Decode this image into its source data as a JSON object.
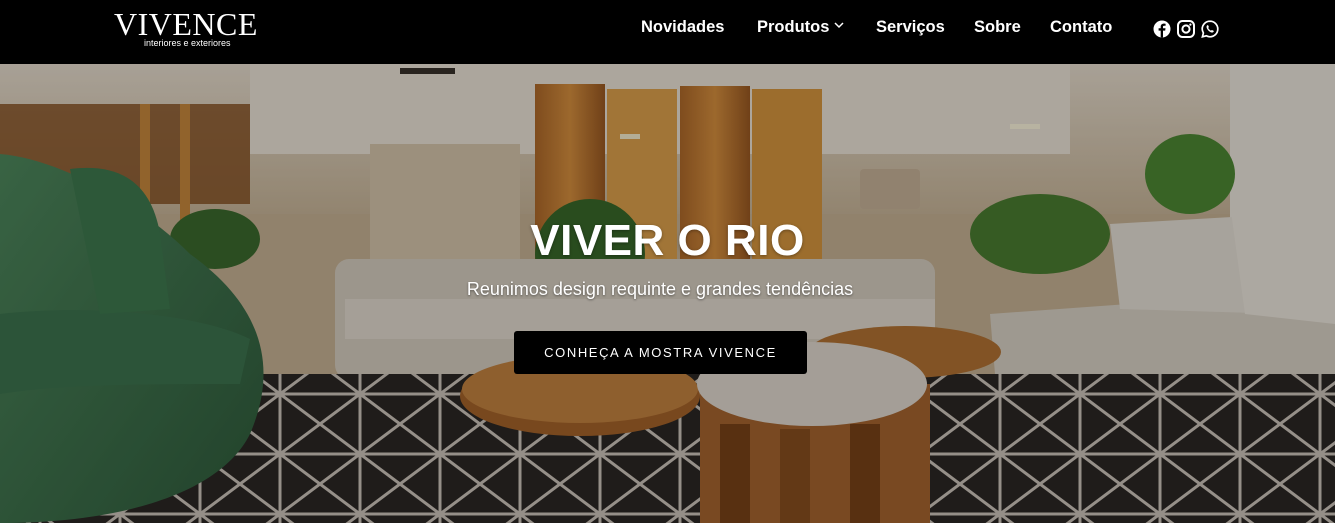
{
  "header": {
    "logo": {
      "main": "VIVENCE",
      "tagline": "interiores e exteriores"
    },
    "nav": [
      {
        "label": "Novidades"
      },
      {
        "label": "Produtos",
        "has_dropdown": true
      },
      {
        "label": "Serviços"
      },
      {
        "label": "Sobre"
      },
      {
        "label": "Contato"
      }
    ],
    "social": [
      "facebook-icon",
      "instagram-icon",
      "whatsapp-icon"
    ]
  },
  "hero": {
    "title": "VIVER O RIO",
    "subtitle": "Reunimos design requinte e grandes tendências",
    "cta_label": "CONHEÇA A MOSTRA VIVENCE"
  },
  "colors": {
    "header_bg": "#000000",
    "text": "#ffffff",
    "cta_bg": "#000000"
  }
}
